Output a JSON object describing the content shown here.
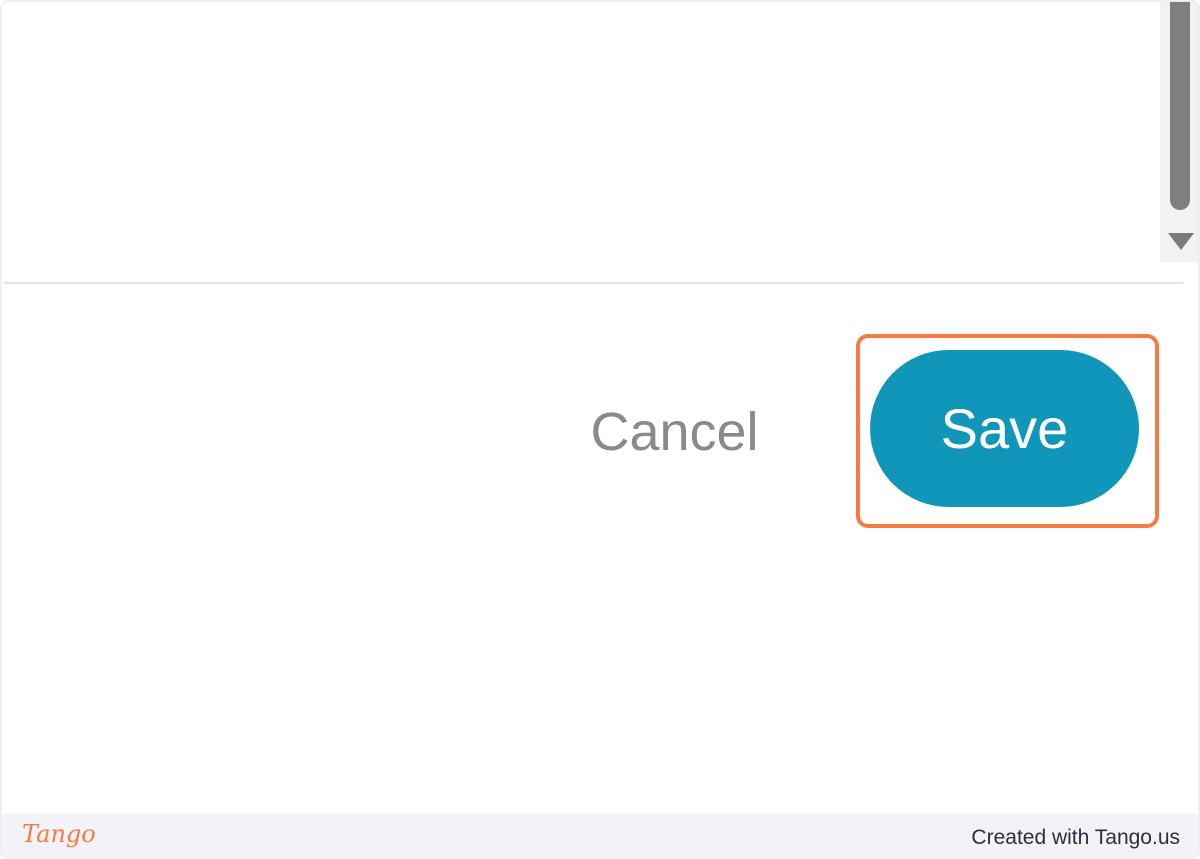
{
  "dialog": {
    "cancel_label": "Cancel",
    "save_label": "Save"
  },
  "scrollbar": {
    "arrow_icon": "triangle-down-icon"
  },
  "colors": {
    "save_button": "#1096b9",
    "highlight": "#f47c44",
    "cancel_text": "#8a8a8a"
  },
  "footer": {
    "logo_text": "Tango",
    "credit": "Created with Tango.us"
  }
}
